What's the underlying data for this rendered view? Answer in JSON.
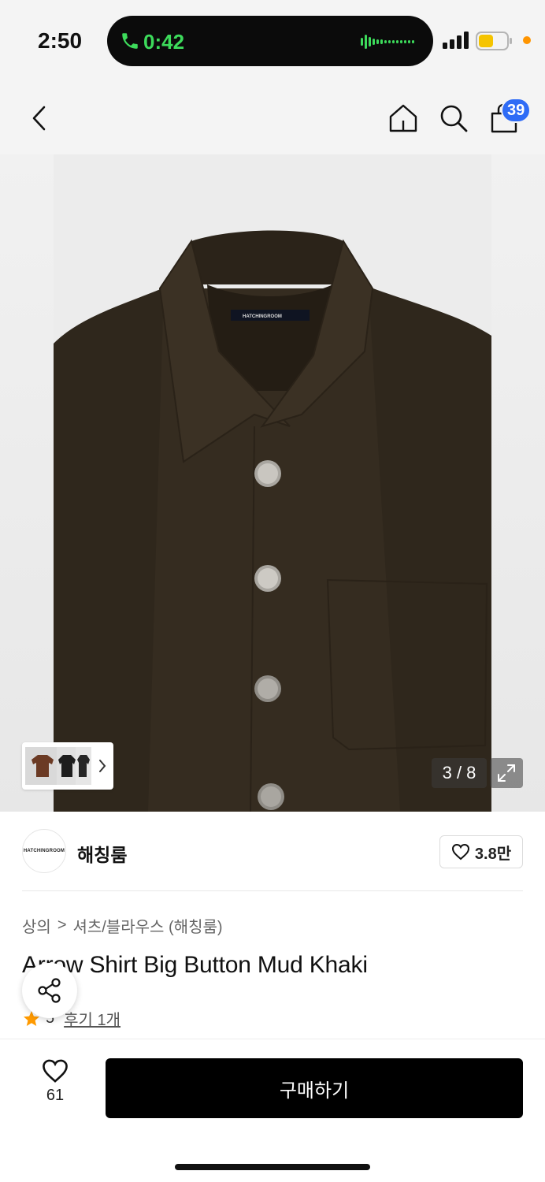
{
  "status_bar": {
    "time": "2:50",
    "call_time": "0:42"
  },
  "nav": {
    "cart_count": "39"
  },
  "gallery": {
    "page_indicator": "3 / 8",
    "label_text": "HATCHINGROOM"
  },
  "brand": {
    "logo_text": "HATCHINGROOM",
    "name": "해칭룸",
    "likes": "3.8만"
  },
  "product": {
    "breadcrumb_1": "상의",
    "breadcrumb_sep": ">",
    "breadcrumb_2": "셔츠/블라우스 (해칭룸)",
    "title": "Arrow Shirt Big Button Mud Khaki",
    "rating": "5",
    "review_text": "후기 1개"
  },
  "bottom": {
    "wish_count": "61",
    "buy_label": "구매하기"
  },
  "colors": {
    "accent_badge": "#2f6cf6",
    "call_green": "#3ddb5b",
    "shirt_color": "#3a3023",
    "star": "#ff9a00"
  }
}
